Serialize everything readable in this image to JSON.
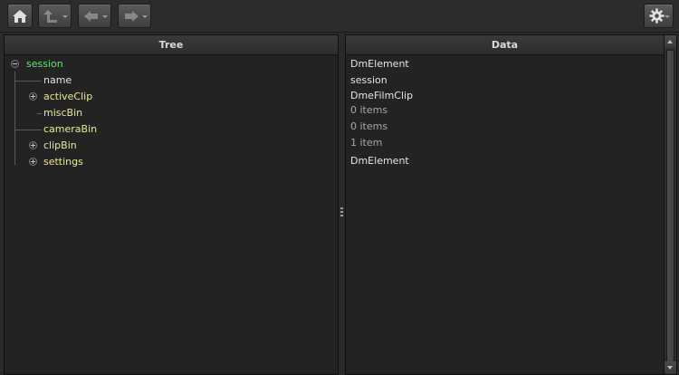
{
  "toolbar": {
    "home_icon": "home-icon",
    "up_icon": "up-arrow-icon",
    "back_icon": "back-arrow-icon",
    "forward_icon": "forward-arrow-icon",
    "settings_icon": "gear-icon"
  },
  "tree_panel": {
    "header": "Tree",
    "items": [
      {
        "label": "session",
        "expanded": true
      },
      {
        "label": "name"
      },
      {
        "label": "activeClip",
        "expandable": true
      },
      {
        "label": "miscBin"
      },
      {
        "label": "cameraBin"
      },
      {
        "label": "clipBin",
        "expandable": true
      },
      {
        "label": "settings",
        "expandable": true
      }
    ]
  },
  "data_panel": {
    "header": "Data",
    "values": [
      "DmElement",
      "session",
      "DmeFilmClip",
      "0 items",
      "0 items",
      "1 item",
      "DmElement"
    ]
  },
  "colors": {
    "root_label": "#6fe06f",
    "element_label": "#e8e8a0",
    "leaf_label": "#e6e6e6",
    "panel_bg": "#232323"
  }
}
